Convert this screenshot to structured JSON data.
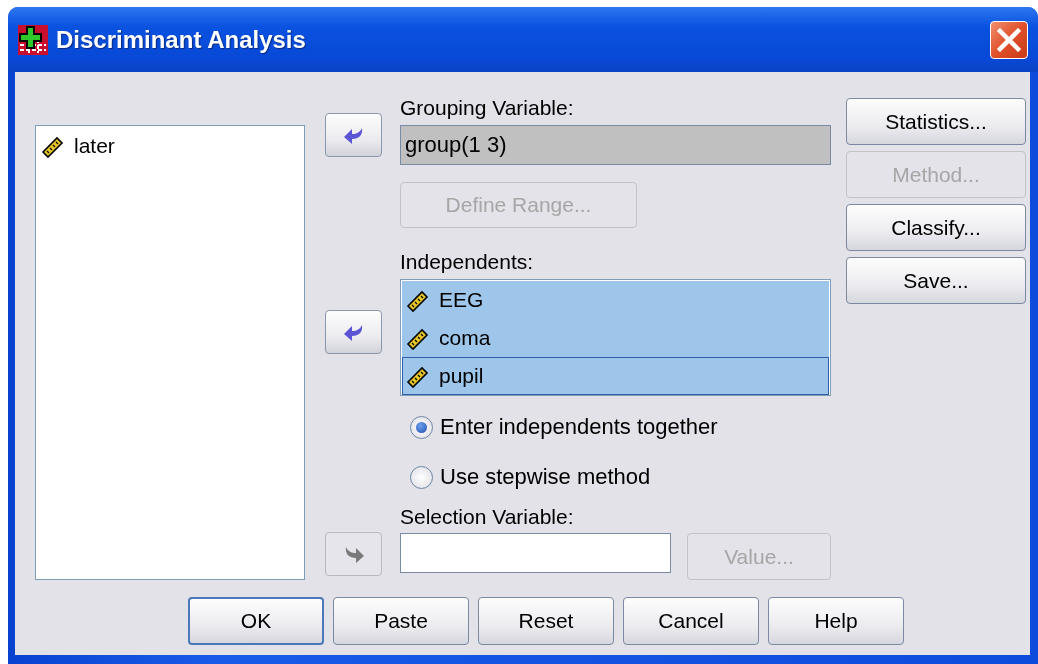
{
  "window": {
    "title": "Discriminant Analysis"
  },
  "source_list": {
    "items": [
      {
        "name": "later",
        "selected": false
      }
    ]
  },
  "arrow_buttons": [
    {
      "kind": "left",
      "disabled": false
    },
    {
      "kind": "left",
      "disabled": false
    },
    {
      "kind": "right",
      "disabled": true
    }
  ],
  "grouping_variable": {
    "label": "Grouping Variable:",
    "value": "group(1 3)"
  },
  "define_range_button": {
    "label": "Define Range...",
    "disabled": true
  },
  "independents": {
    "label": "Independents:",
    "items": [
      {
        "name": "EEG",
        "selected": true,
        "focused": false
      },
      {
        "name": "coma",
        "selected": true,
        "focused": false
      },
      {
        "name": "pupil",
        "selected": true,
        "focused": true
      }
    ]
  },
  "method_options": [
    {
      "label": "Enter independents together",
      "selected": true
    },
    {
      "label": "Use stepwise method",
      "selected": false
    }
  ],
  "selection_variable": {
    "label": "Selection Variable:"
  },
  "value_button": {
    "label": "Value...",
    "disabled": true
  },
  "side_buttons": [
    {
      "label": "Statistics...",
      "disabled": false
    },
    {
      "label": "Method...",
      "disabled": true
    },
    {
      "label": "Classify...",
      "disabled": false
    },
    {
      "label": "Save...",
      "disabled": false
    }
  ],
  "footer_buttons": [
    {
      "label": "OK",
      "default": true
    },
    {
      "label": "Paste",
      "default": false
    },
    {
      "label": "Reset",
      "default": false
    },
    {
      "label": "Cancel",
      "default": false
    },
    {
      "label": "Help",
      "default": false
    }
  ]
}
